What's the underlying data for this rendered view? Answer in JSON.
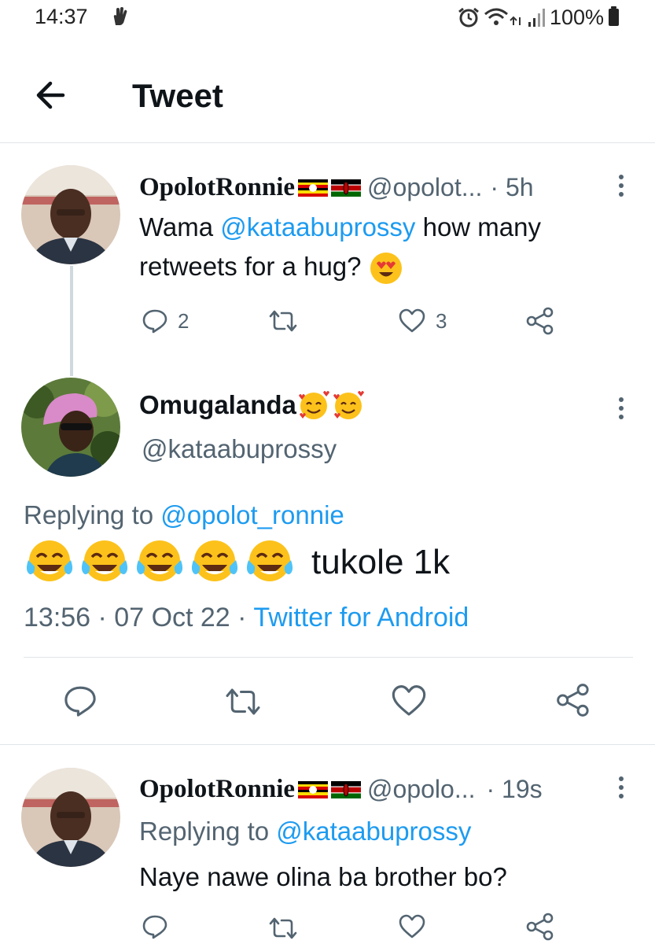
{
  "status_bar": {
    "time": "14:37",
    "battery": "100%"
  },
  "header": {
    "title": "Tweet"
  },
  "tweets": [
    {
      "name": "OpolotRonnie",
      "handle": "@opolot...",
      "time": "· 5h",
      "text_parts": [
        "Wama ",
        "@kataabuprossy",
        " how many",
        "retweets for a hug?"
      ],
      "replies": "2",
      "retweets": "",
      "likes": "3"
    },
    {
      "name": "Omugalanda",
      "handle": "@kataabuprossy",
      "replying_label": "Replying to ",
      "replying_to": "@opolot_ronnie",
      "text": "tukole 1k",
      "timestamp": "13:56 · 07 Oct 22 · ",
      "source": "Twitter for Android"
    },
    {
      "name": "OpolotRonnie",
      "handle": "@opolo...",
      "time": "· 19s",
      "replying_label": "Replying to ",
      "replying_to": "@kataabuprossy",
      "text": "Naye nawe olina ba brother bo?"
    }
  ],
  "icons": {
    "back": "arrow-left-icon",
    "reply": "reply-icon",
    "retweet": "retweet-icon",
    "like": "heart-icon",
    "share": "share-icon",
    "more": "more-vertical-icon"
  },
  "colors": {
    "accent": "#1d9bf0",
    "muted": "#536471",
    "text": "#0f1419",
    "divider": "#e1e5e8"
  }
}
